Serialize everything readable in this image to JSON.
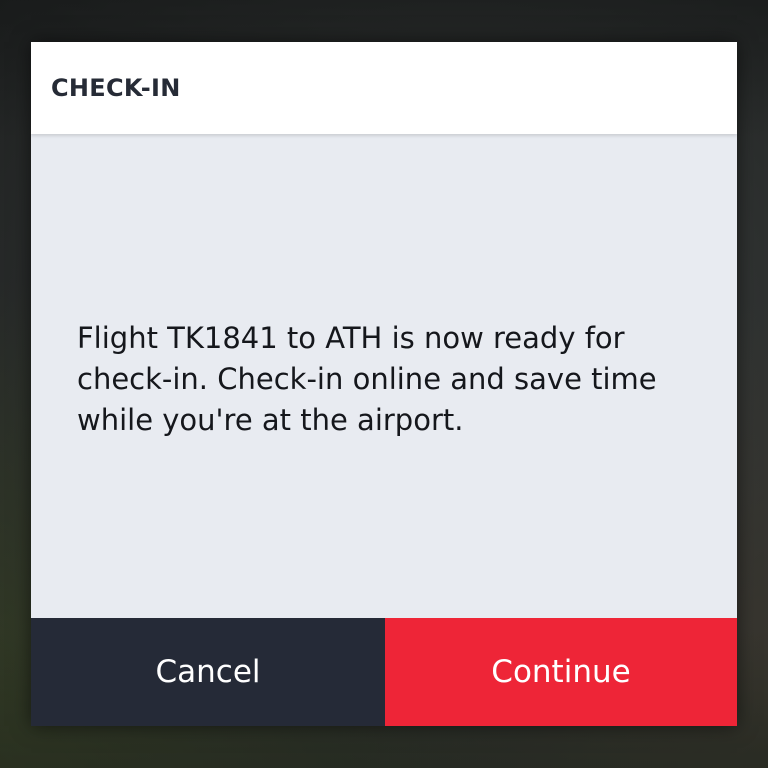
{
  "dialog": {
    "title": "CHECK-IN",
    "message": "Flight TK1841 to ATH is now ready for check-in. Check-in online and save time while you're at the airport.",
    "cancel_label": "Cancel",
    "continue_label": "Continue"
  },
  "colors": {
    "header_bg": "#ffffff",
    "body_bg": "#e8ebf1",
    "cancel_bg": "#252a37",
    "continue_bg": "#ee2537",
    "title_text": "#262b36"
  }
}
